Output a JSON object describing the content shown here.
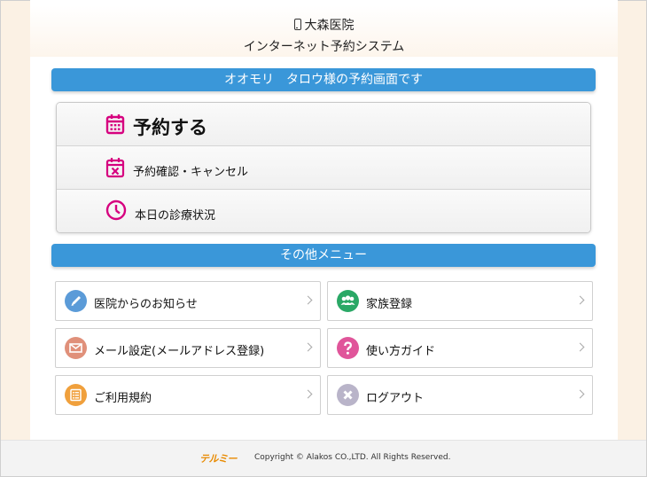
{
  "header": {
    "clinic_name": "大森医院",
    "system_name": "インターネット予約システム"
  },
  "greeting_bar": "オオモリ　タロウ様の予約画面です",
  "main_menu": [
    {
      "label": "予約する",
      "icon": "calendar-icon",
      "color": "#d6007f"
    },
    {
      "label": "予約確認・キャンセル",
      "icon": "calendar-cancel-icon",
      "color": "#d6007f"
    },
    {
      "label": "本日の診療状況",
      "icon": "clock-icon",
      "color": "#d6007f"
    }
  ],
  "other_menu_title": "その他メニュー",
  "other_menu": [
    {
      "label": "医院からのお知らせ",
      "icon": "pencil-icon",
      "color": "#5b9bd8"
    },
    {
      "label": "家族登録",
      "icon": "family-icon",
      "color": "#2aa866"
    },
    {
      "label": "メール設定(メールアドレス登録)",
      "icon": "mail-icon",
      "color": "#e0907a"
    },
    {
      "label": "使い方ガイド",
      "icon": "question-icon",
      "color": "#e0559a"
    },
    {
      "label": "ご利用規約",
      "icon": "list-icon",
      "color": "#f0a03c"
    },
    {
      "label": "ログアウト",
      "icon": "logout-icon",
      "color": "#b9b4c9"
    }
  ],
  "footer": {
    "logo": "テルミー",
    "copyright": "Copyright © Alakos CO.,LTD. All Rights Reserved."
  },
  "colors": {
    "accent_blue": "#3a97d9",
    "page_bg": "#fbf1e4"
  }
}
